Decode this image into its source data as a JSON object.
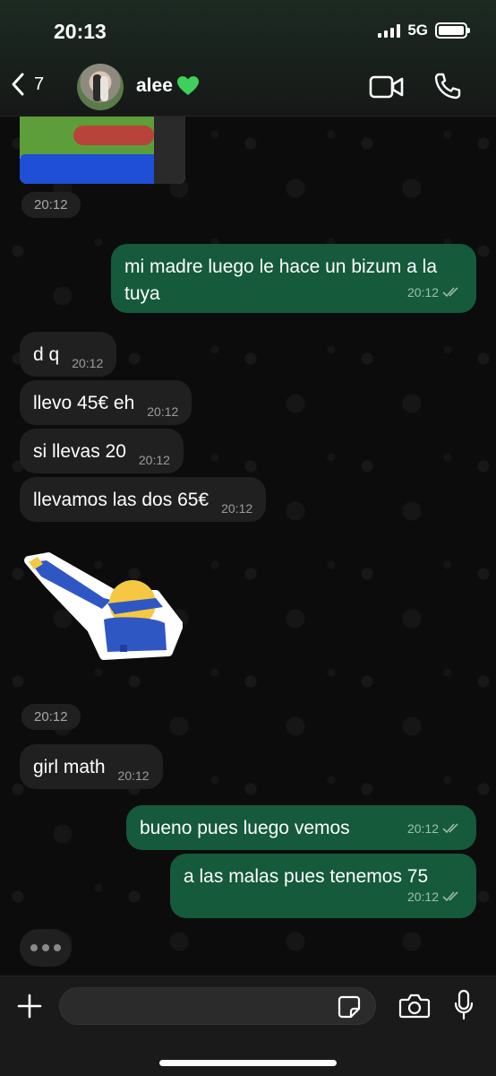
{
  "status_bar": {
    "time": "20:13",
    "network": "5G"
  },
  "header": {
    "back_count": "7",
    "contact_name": "alee"
  },
  "messages": [
    {
      "dir": "in",
      "kind": "sticker-time",
      "time": "20:12"
    },
    {
      "dir": "out",
      "text": "mi madre luego le hace un bizum a la tuya",
      "time": "20:12",
      "read": true
    },
    {
      "dir": "in",
      "text": "d q",
      "time": "20:12"
    },
    {
      "dir": "in",
      "text": "llevo 45€ eh",
      "time": "20:12"
    },
    {
      "dir": "in",
      "text": "si llevas 20",
      "time": "20:12"
    },
    {
      "dir": "in",
      "text": "llevamos las dos 65€",
      "time": "20:12"
    },
    {
      "dir": "in",
      "kind": "sticker-time",
      "time": "20:12"
    },
    {
      "dir": "in",
      "text": "girl math",
      "time": "20:12"
    },
    {
      "dir": "out",
      "text": "bueno pues luego vemos",
      "time": "20:12",
      "read": true
    },
    {
      "dir": "out",
      "text": "a las malas pues tenemos 75",
      "time": "20:12",
      "read": true
    }
  ],
  "composer": {
    "value": "",
    "placeholder": ""
  },
  "colors": {
    "incoming": "#202020",
    "outgoing": "#145a3b",
    "background": "#0c0c0c"
  }
}
